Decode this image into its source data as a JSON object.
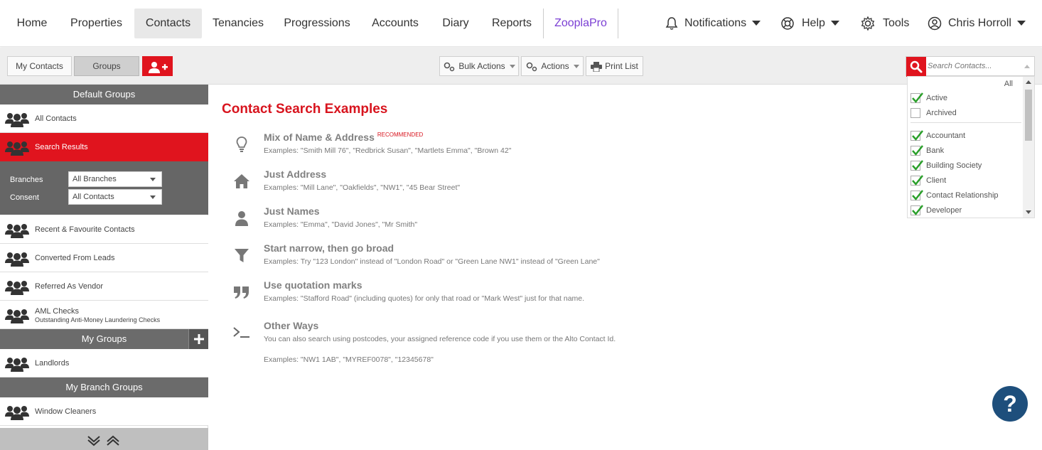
{
  "nav": {
    "items": [
      {
        "label": "Home"
      },
      {
        "label": "Properties"
      },
      {
        "label": "Contacts"
      },
      {
        "label": "Tenancies"
      },
      {
        "label": "Progressions"
      },
      {
        "label": "Accounts"
      },
      {
        "label": "Diary"
      },
      {
        "label": "Reports"
      },
      {
        "label": "ZooplaPro"
      }
    ],
    "active": "Contacts",
    "notifications": "Notifications",
    "help": "Help",
    "tools": "Tools",
    "user": "Chris Horroll"
  },
  "toolbar": {
    "my_contacts": "My Contacts",
    "groups": "Groups",
    "bulk_actions": "Bulk Actions",
    "actions": "Actions",
    "print_list": "Print List"
  },
  "search": {
    "placeholder": "Search Contacts...",
    "all_label": "All",
    "status": [
      {
        "label": "Active",
        "checked": true
      },
      {
        "label": "Archived",
        "checked": false
      }
    ],
    "types": [
      {
        "label": "Accountant",
        "checked": true
      },
      {
        "label": "Bank",
        "checked": true
      },
      {
        "label": "Building Society",
        "checked": true
      },
      {
        "label": "Client",
        "checked": true
      },
      {
        "label": "Contact Relationship",
        "checked": true
      },
      {
        "label": "Developer",
        "checked": true
      }
    ]
  },
  "sidebar": {
    "default_groups_title": "Default Groups",
    "all_contacts": "All Contacts",
    "search_results": "Search Results",
    "branches_label": "Branches",
    "branches_value": "All Branches",
    "consent_label": "Consent",
    "consent_value": "All Contacts",
    "recent": "Recent & Favourite Contacts",
    "converted": "Converted From Leads",
    "referred": "Referred As Vendor",
    "aml": "AML Checks",
    "aml_sub": "Outstanding Anti-Money Laundering Checks",
    "my_groups_title": "My Groups",
    "landlords": "Landlords",
    "my_branch_groups_title": "My Branch Groups",
    "window_cleaners": "Window Cleaners"
  },
  "main": {
    "title": "Contact Search Examples",
    "examples": [
      {
        "icon": "lightbulb-icon",
        "title": "Mix of Name & Address",
        "badge": "RECOMMENDED",
        "desc": "Examples: \"Smith Mill 76\", \"Redbrick Susan\", \"Martlets Emma\", \"Brown 42\""
      },
      {
        "icon": "home-icon",
        "title": "Just Address",
        "desc": "Examples: \"Mill Lane\", \"Oakfields\", \"NW1\", \"45 Bear Street\""
      },
      {
        "icon": "person-icon",
        "title": "Just Names",
        "desc": "Examples: \"Emma\", \"David Jones\", \"Mr Smith\""
      },
      {
        "icon": "filter-icon",
        "title": "Start narrow, then go broad",
        "desc": "Examples: Try \"123 London\" instead of \"London Road\" or \"Green Lane NW1\" instead of \"Green Lane\""
      },
      {
        "icon": "quote-icon",
        "title": "Use quotation marks",
        "desc": "Examples: \"Stafford Road\" (including quotes) for only that road or \"Mark West\" just for that name."
      },
      {
        "icon": "terminal-icon",
        "title": "Other Ways",
        "desc": "You can also search using postcodes, your assigned reference code if you use them or the Alto Contact Id.",
        "desc2": "Examples: \"NW1 1AB\", \"MYREF0078\", \"12345678\""
      }
    ]
  },
  "help_fab": "?",
  "colors": {
    "accent": "#e0141e",
    "zoopla": "#7b3fd4",
    "fab": "#1e4f7c"
  }
}
